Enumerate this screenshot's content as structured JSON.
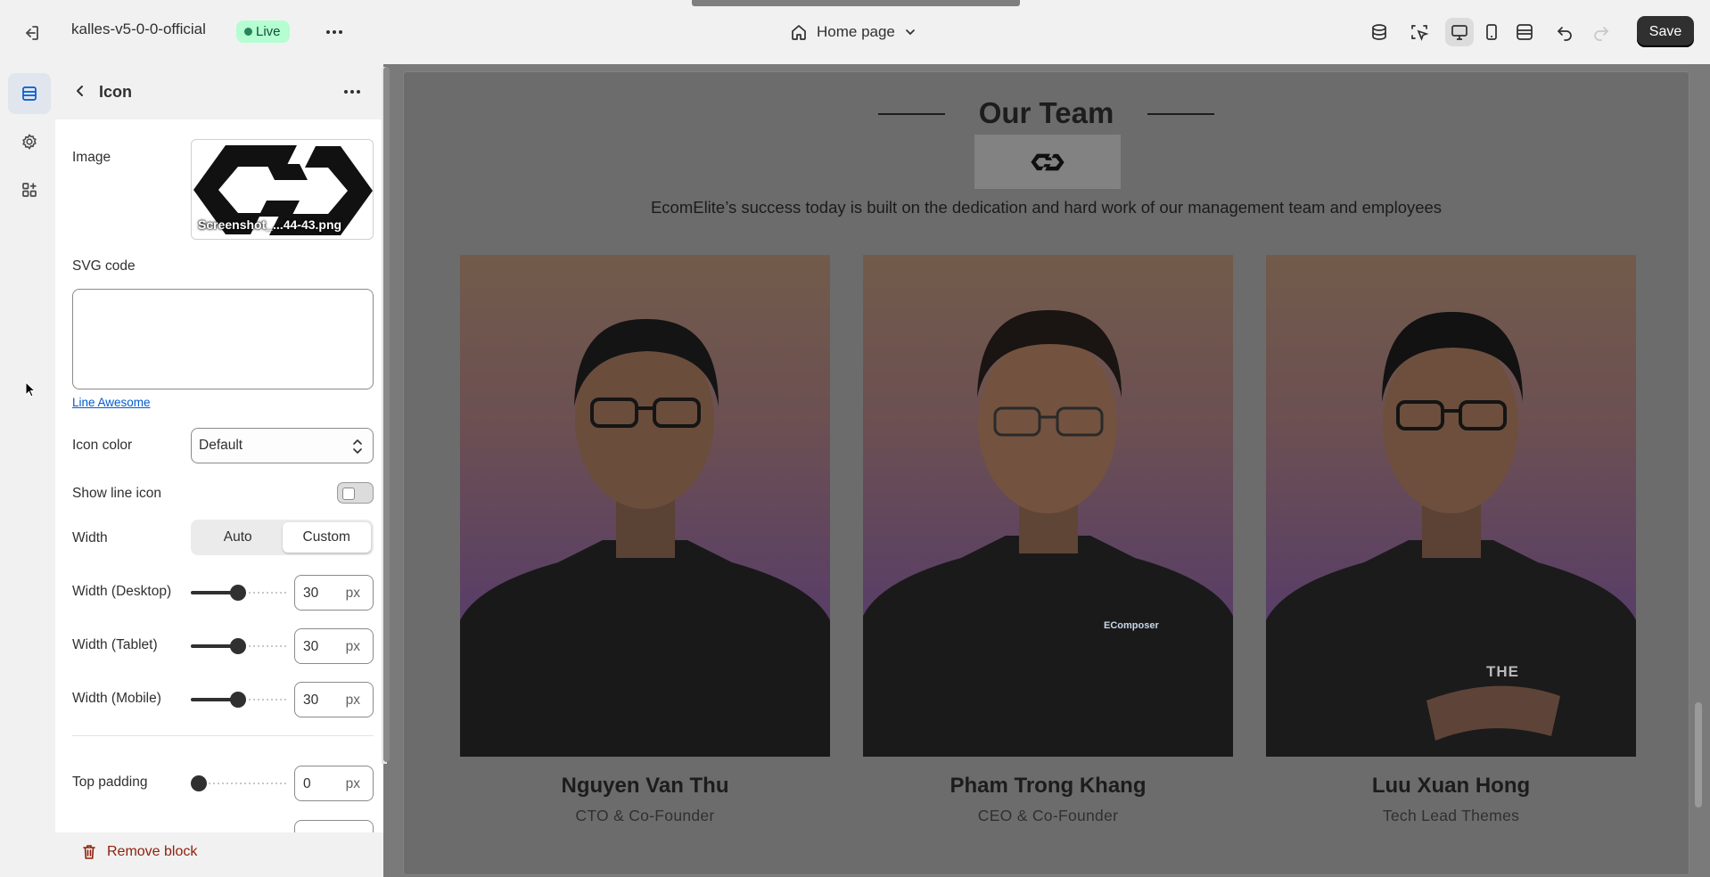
{
  "topbar": {
    "store_name": "kalles-v5-0-0-official",
    "status_badge": "Live",
    "page_select": "Home page",
    "save_label": "Save"
  },
  "panel": {
    "title": "Icon",
    "image_label": "Image",
    "image_filename": "Screenshot_...44-43.png",
    "svg_code_label": "SVG code",
    "svg_code_value": "",
    "line_awesome_link": "Line Awesome",
    "icon_color_label": "Icon color",
    "icon_color_value": "Default",
    "show_line_icon_label": "Show line icon",
    "show_line_icon": false,
    "width_label": "Width",
    "width_options": [
      "Auto",
      "Custom"
    ],
    "width_selected": "Custom",
    "width_desktop": {
      "label": "Width (Desktop)",
      "value": "30",
      "unit": "px"
    },
    "width_tablet": {
      "label": "Width (Tablet)",
      "value": "30",
      "unit": "px"
    },
    "width_mobile": {
      "label": "Width (Mobile)",
      "value": "30",
      "unit": "px"
    },
    "top_padding": {
      "label": "Top padding",
      "value": "0",
      "unit": "px"
    },
    "remove_block_label": "Remove block"
  },
  "preview": {
    "section_title": "Our Team",
    "subtitle": "EcomElite’s success today is built on the dedication and hard work of our management team and employees",
    "members": [
      {
        "name": "Nguyen Van Thu",
        "role": "CTO & Co-Founder"
      },
      {
        "name": "Pham Trong Khang",
        "role": "CEO & Co-Founder",
        "shirt_text": "EComposer"
      },
      {
        "name": "Luu Xuan Hong",
        "role": "Tech Lead Themes",
        "shirt_text": "THE"
      }
    ]
  },
  "colors": {
    "save_bg": "#303030",
    "live_badge_bg": "#b4fed2",
    "link": "#005bd3",
    "remove_text": "#8e1f0b",
    "overlay": "#7a7a7a"
  }
}
